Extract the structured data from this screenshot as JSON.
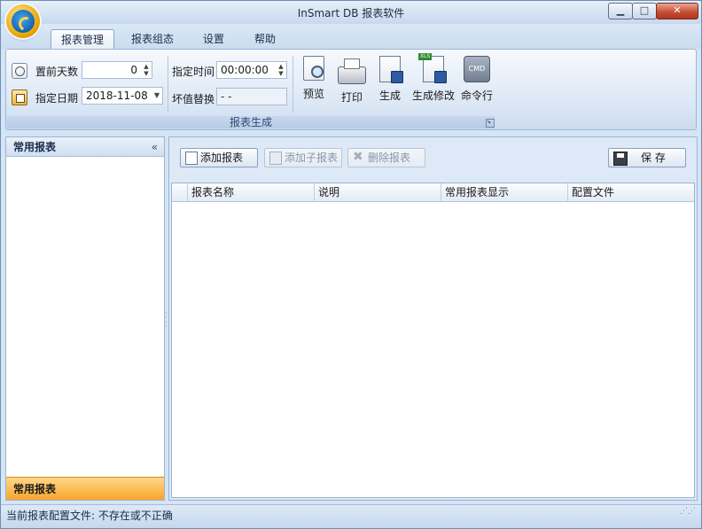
{
  "window": {
    "title": "InSmart DB 报表软件",
    "controls": {
      "minimize": "▁",
      "maximize": "□",
      "close": "✕"
    }
  },
  "menu": {
    "tabs": [
      "报表管理",
      "报表组态",
      "设置",
      "帮助"
    ],
    "active": "报表管理"
  },
  "ribbon": {
    "fields": {
      "days_before_label": "置前天数",
      "days_before_value": "0",
      "date_label": "指定日期",
      "date_value": "2018-11-08",
      "time_label": "指定时间",
      "time_value": "00:00:00",
      "bad_value_label": "坏值替换",
      "bad_value_value": "- -"
    },
    "buttons": [
      "预览",
      "打印",
      "生成",
      "生成修改",
      "命令行"
    ],
    "cmd_icon_text": "CMD",
    "xls_badge": "XLS",
    "group_label": "报表生成"
  },
  "left_panel": {
    "header": "常用报表",
    "collapse_glyph": "«",
    "footer": "常用报表"
  },
  "toolbar": {
    "add": "添加报表",
    "add_child": "添加子报表",
    "delete": "删除报表",
    "save": "保  存"
  },
  "grid": {
    "columns": [
      "报表名称",
      "说明",
      "常用报表显示",
      "配置文件"
    ],
    "rows": []
  },
  "status": {
    "text": "当前报表配置文件: 不存在或不正确"
  },
  "colors": {
    "accent": "#cfe0f2",
    "footer_orange": "#f7a72b",
    "close_red": "#c44a30"
  }
}
